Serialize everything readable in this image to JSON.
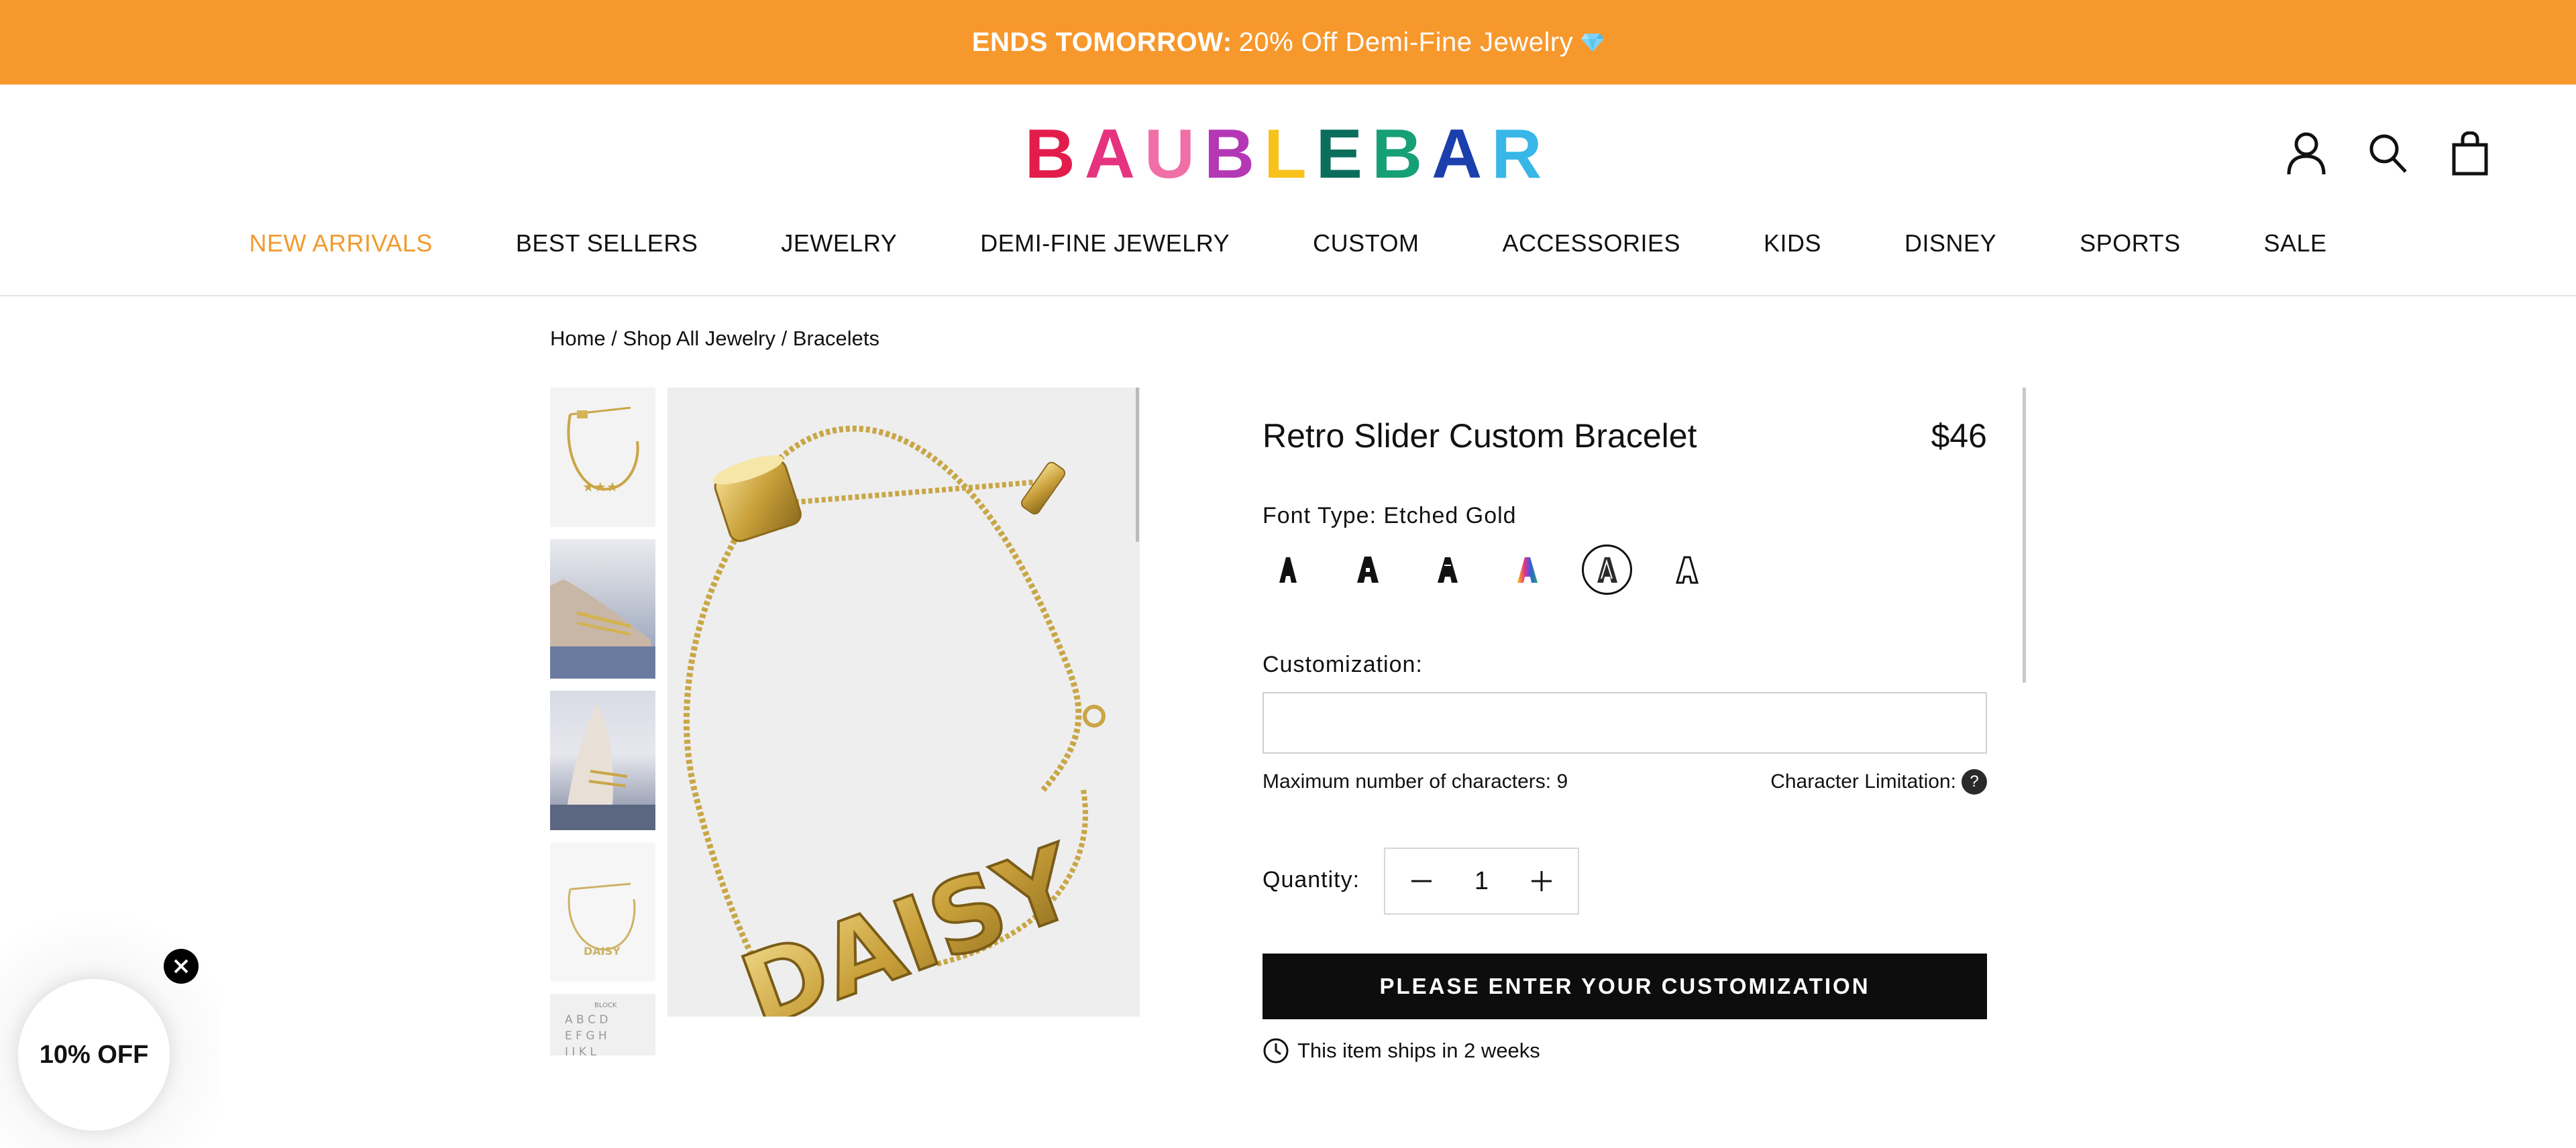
{
  "promo": {
    "bold": "ENDS TOMORROW:",
    "text": "20% Off Demi-Fine Jewelry"
  },
  "logo": {
    "letters": [
      {
        "ch": "B",
        "color": "#E31D4B"
      },
      {
        "ch": "A",
        "color": "#E6337F"
      },
      {
        "ch": "U",
        "color": "#EF6FA6"
      },
      {
        "ch": "B",
        "color": "#B438B6"
      },
      {
        "ch": "L",
        "color": "#F8C21A"
      },
      {
        "ch": "E",
        "color": "#0B6E5C"
      },
      {
        "ch": "B",
        "color": "#16A075"
      },
      {
        "ch": "A",
        "color": "#1C3FAE"
      },
      {
        "ch": "R",
        "color": "#38B6E8"
      }
    ]
  },
  "nav": {
    "items": [
      "NEW ARRIVALS",
      "BEST SELLERS",
      "JEWELRY",
      "DEMI-FINE JEWELRY",
      "CUSTOM",
      "ACCESSORIES",
      "KIDS",
      "DISNEY",
      "SPORTS",
      "SALE"
    ],
    "active_color": "#F29A2E"
  },
  "breadcrumb": "Home / Shop All Jewelry / Bracelets",
  "product": {
    "title": "Retro Slider Custom Bracelet",
    "price": "$46",
    "font_label": "Font Type: Etched Gold",
    "fonts": [
      "black-solid",
      "black-bubble",
      "black-bold",
      "rainbow",
      "etched-gold",
      "outline"
    ],
    "selected_font_index": 4,
    "customization_label": "Customization:",
    "customization_value": "",
    "max_chars": "Maximum number of characters: 9",
    "char_limitation": "Character Limitation:",
    "help_glyph": "?",
    "quantity_label": "Quantity:",
    "quantity": "1",
    "cta": "PLEASE ENTER YOUR CUSTOMIZATION",
    "ships": "This item ships in 2 weeks",
    "image_text": "DAISY"
  },
  "popup": {
    "label": "10% OFF"
  },
  "thumbs": {
    "alphabet": "BLOCK\nA B C D\nE F G H\nI J K L"
  }
}
